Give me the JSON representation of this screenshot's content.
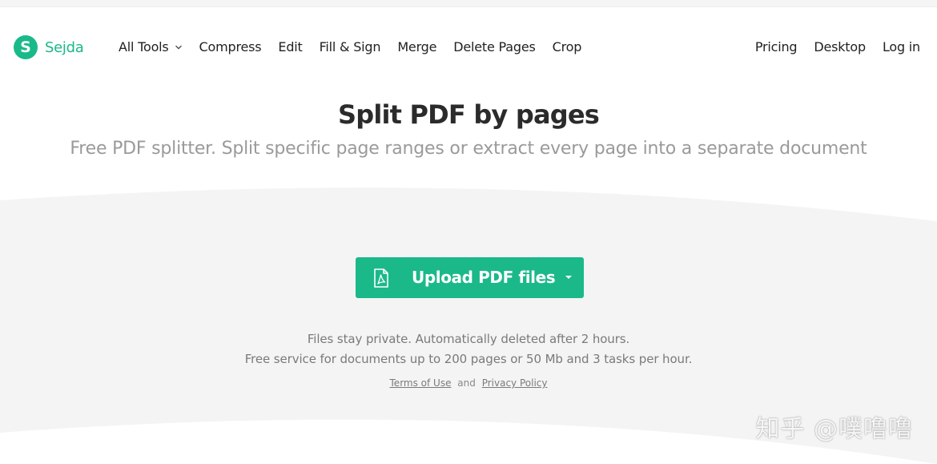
{
  "brand": {
    "logo_letter": "S",
    "name": "Sejda",
    "color": "#1ab98a"
  },
  "nav": {
    "left": [
      {
        "label": "All Tools",
        "has_dropdown": true
      },
      {
        "label": "Compress"
      },
      {
        "label": "Edit"
      },
      {
        "label": "Fill & Sign"
      },
      {
        "label": "Merge"
      },
      {
        "label": "Delete Pages"
      },
      {
        "label": "Crop"
      }
    ],
    "right": [
      {
        "label": "Pricing"
      },
      {
        "label": "Desktop"
      },
      {
        "label": "Log in"
      }
    ]
  },
  "hero": {
    "title": "Split PDF by pages",
    "subtitle": "Free PDF splitter. Split specific page ranges or extract every page into a separate document"
  },
  "upload": {
    "label": "Upload PDF files",
    "icon": "pdf-file-icon",
    "dropdown_icon": "caret-down-icon",
    "color": "#1bb98a"
  },
  "info": {
    "line1": "Files stay private. Automatically deleted after 2 hours.",
    "line2": "Free service for documents up to 200 pages or 50 Mb and 3 tasks per hour."
  },
  "legal": {
    "terms": "Terms of Use",
    "and": "and",
    "privacy": "Privacy Policy"
  },
  "watermark": {
    "text": "知乎 @噗噜噜"
  },
  "colors": {
    "band": "#f4f4f4",
    "title": "#2b2b2b",
    "subtitle": "#9a9a9a"
  }
}
